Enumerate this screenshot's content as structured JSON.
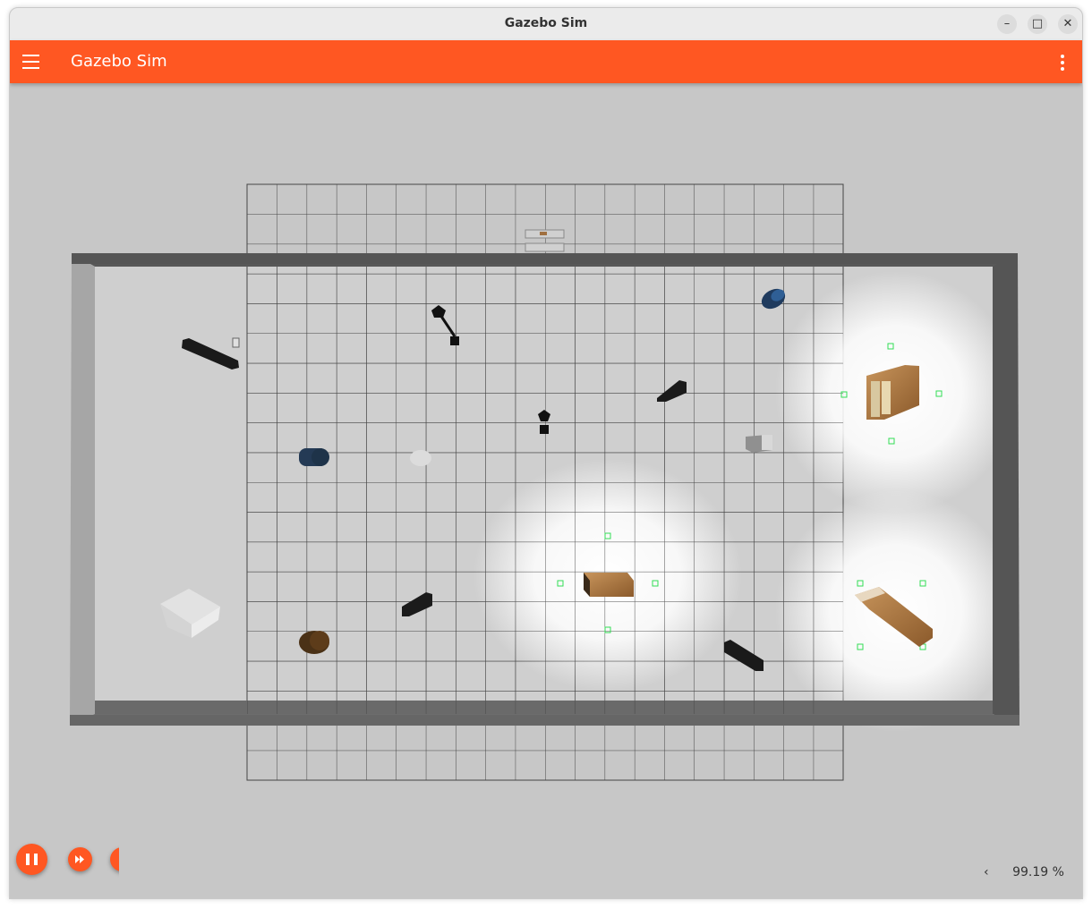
{
  "window": {
    "title": "Gazebo Sim",
    "controls": {
      "minimize": "–",
      "maximize": "□",
      "close": "✕"
    }
  },
  "appbar": {
    "title": "Gazebo Sim",
    "accent_color": "#ff5722",
    "menu_icon": "hamburger-menu-icon",
    "overflow_icon": "vertical-dots-icon"
  },
  "scene": {
    "background_color": "#c7c7c7",
    "objects": [
      "walls",
      "grid",
      "bookshelves",
      "barrels",
      "cubes",
      "cardboard-box",
      "lights",
      "tables",
      "chairs"
    ]
  },
  "playback": {
    "play_pause_icon": "pause-icon",
    "step_icon": "fast-forward-icon",
    "third_icon": "partially-hidden-button"
  },
  "stats": {
    "collapse_icon": "chevron-left-icon",
    "real_time_factor": "99.19 %"
  }
}
